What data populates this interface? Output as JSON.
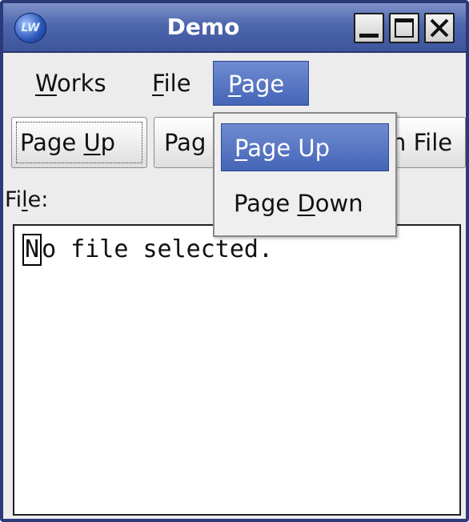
{
  "window": {
    "title": "Demo",
    "app_icon_text": "LW",
    "controls": {
      "minimize_icon": "minimize-icon",
      "maximize_icon": "maximize-icon",
      "close_icon": "close-icon"
    }
  },
  "menubar": {
    "items": [
      {
        "label_underlined": "W",
        "label_rest": "orks"
      },
      {
        "label_underlined": "F",
        "label_rest": "ile"
      },
      {
        "label_underlined": "P",
        "label_rest": "age"
      }
    ]
  },
  "toolbar": {
    "page_up": {
      "before": "Page ",
      "underlined": "U",
      "after": "p"
    },
    "page_down_visible": "Pag",
    "open_file_visible": "n File"
  },
  "file_label": {
    "before": "Fi",
    "underlined": "l",
    "after": "e:"
  },
  "text_area": {
    "caret_char": "N",
    "rest": "o file selected."
  },
  "dropdown": {
    "items": [
      {
        "underlined": "P",
        "rest": "age Up",
        "highlighted": true
      },
      {
        "before": "Page ",
        "underlined": "D",
        "rest": "own",
        "highlighted": false
      }
    ]
  },
  "colors": {
    "titlebar": "#4d66ad",
    "highlight": "#4565b8",
    "background": "#ececec"
  }
}
